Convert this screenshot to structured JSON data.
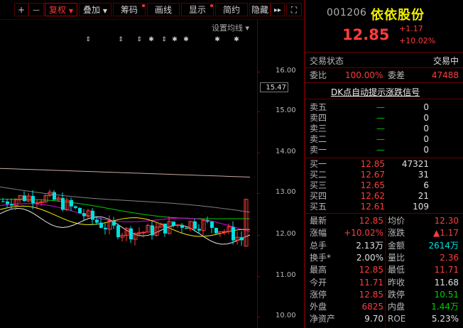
{
  "toolbar": {
    "plus": "+",
    "minus": "—",
    "restore_rights": "复权",
    "overlay": "叠加",
    "chips": "筹码",
    "draw_line": "画线",
    "display": "显示",
    "simple": "简约",
    "hide": "隐藏",
    "more": "▸▸",
    "fullscreen": "⛶"
  },
  "chart": {
    "ma_setting_label": "设置均线",
    "ma_setting_caret": "▾",
    "price_labels": [
      "16.00",
      "15.00",
      "14.00",
      "13.00",
      "12.00",
      "11.00",
      "10.00"
    ],
    "current_price_tag": "15.47",
    "colors": {
      "up": "#ff3c3c",
      "down": "#00e0e0",
      "ma5": "#e8e8e8",
      "ma10": "#f0f000",
      "ma20": "#e000e0",
      "ma30": "#00d000",
      "ma60": "#808080",
      "ma120": "#c8a8a0"
    }
  },
  "quote": {
    "code": "001206",
    "name": "依依股份",
    "price": "12.85",
    "change": "+1.17",
    "change_pct": "+10.02%",
    "trade_status_label": "交易状态",
    "trade_status_value": "交易中",
    "committee_ratio_label": "委比",
    "committee_ratio_value": "100.00%",
    "committee_diff_label": "委差",
    "committee_diff_value": "47488",
    "dk_link": "DK点自动提示涨跌信号",
    "sells": [
      {
        "label": "卖五",
        "price": "—",
        "vol": "0"
      },
      {
        "label": "卖四",
        "price": "—",
        "vol": "0"
      },
      {
        "label": "卖三",
        "price": "—",
        "vol": "0"
      },
      {
        "label": "卖二",
        "price": "—",
        "vol": "0"
      },
      {
        "label": "卖一",
        "price": "—",
        "vol": "0"
      }
    ],
    "buys": [
      {
        "label": "买一",
        "price": "12.85",
        "vol": "47321"
      },
      {
        "label": "买二",
        "price": "12.67",
        "vol": "31"
      },
      {
        "label": "买三",
        "price": "12.65",
        "vol": "6"
      },
      {
        "label": "买四",
        "price": "12.62",
        "vol": "21"
      },
      {
        "label": "买五",
        "price": "12.61",
        "vol": "109"
      }
    ],
    "stats": [
      {
        "l1": "最新",
        "v1": "12.85",
        "c1": "red",
        "l2": "均价",
        "v2": "12.30",
        "c2": "red"
      },
      {
        "l1": "涨幅",
        "v1": "+10.02%",
        "c1": "red",
        "l2": "涨跌",
        "v2": "▲1.17",
        "c2": "red"
      },
      {
        "l1": "总手",
        "v1": "2.13万",
        "c1": "wht",
        "l2": "金额",
        "v2": "2614万",
        "c2": "cyan"
      },
      {
        "l1": "换手*",
        "v1": "2.00%",
        "c1": "wht",
        "l2": "量比",
        "v2": "2.36",
        "c2": "red"
      },
      {
        "l1": "最高",
        "v1": "12.85",
        "c1": "red",
        "l2": "最低",
        "v2": "11.71",
        "c2": "red"
      },
      {
        "l1": "今开",
        "v1": "11.71",
        "c1": "red",
        "l2": "昨收",
        "v2": "11.68",
        "c2": "wht"
      },
      {
        "l1": "涨停",
        "v1": "12.85",
        "c1": "red",
        "l2": "跌停",
        "v2": "10.51",
        "c2": "grn"
      },
      {
        "l1": "外盘",
        "v1": "6825",
        "c1": "red",
        "l2": "内盘",
        "v2": "1.44万",
        "c2": "grn"
      },
      {
        "l1": "净资产",
        "v1": "9.70",
        "c1": "wht",
        "l2": "ROE",
        "v2": "5.23%",
        "c2": "wht"
      }
    ]
  }
}
